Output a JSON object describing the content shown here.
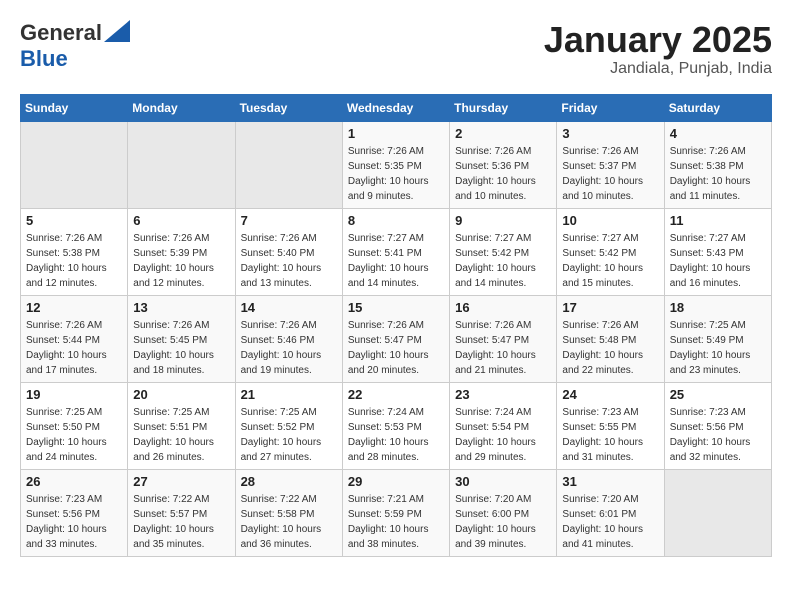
{
  "header": {
    "logo_line1": "General",
    "logo_line2": "Blue",
    "month": "January 2025",
    "location": "Jandiala, Punjab, India"
  },
  "days_of_week": [
    "Sunday",
    "Monday",
    "Tuesday",
    "Wednesday",
    "Thursday",
    "Friday",
    "Saturday"
  ],
  "weeks": [
    [
      {
        "day": "",
        "info": ""
      },
      {
        "day": "",
        "info": ""
      },
      {
        "day": "",
        "info": ""
      },
      {
        "day": "1",
        "info": "Sunrise: 7:26 AM\nSunset: 5:35 PM\nDaylight: 10 hours\nand 9 minutes."
      },
      {
        "day": "2",
        "info": "Sunrise: 7:26 AM\nSunset: 5:36 PM\nDaylight: 10 hours\nand 10 minutes."
      },
      {
        "day": "3",
        "info": "Sunrise: 7:26 AM\nSunset: 5:37 PM\nDaylight: 10 hours\nand 10 minutes."
      },
      {
        "day": "4",
        "info": "Sunrise: 7:26 AM\nSunset: 5:38 PM\nDaylight: 10 hours\nand 11 minutes."
      }
    ],
    [
      {
        "day": "5",
        "info": "Sunrise: 7:26 AM\nSunset: 5:38 PM\nDaylight: 10 hours\nand 12 minutes."
      },
      {
        "day": "6",
        "info": "Sunrise: 7:26 AM\nSunset: 5:39 PM\nDaylight: 10 hours\nand 12 minutes."
      },
      {
        "day": "7",
        "info": "Sunrise: 7:26 AM\nSunset: 5:40 PM\nDaylight: 10 hours\nand 13 minutes."
      },
      {
        "day": "8",
        "info": "Sunrise: 7:27 AM\nSunset: 5:41 PM\nDaylight: 10 hours\nand 14 minutes."
      },
      {
        "day": "9",
        "info": "Sunrise: 7:27 AM\nSunset: 5:42 PM\nDaylight: 10 hours\nand 14 minutes."
      },
      {
        "day": "10",
        "info": "Sunrise: 7:27 AM\nSunset: 5:42 PM\nDaylight: 10 hours\nand 15 minutes."
      },
      {
        "day": "11",
        "info": "Sunrise: 7:27 AM\nSunset: 5:43 PM\nDaylight: 10 hours\nand 16 minutes."
      }
    ],
    [
      {
        "day": "12",
        "info": "Sunrise: 7:26 AM\nSunset: 5:44 PM\nDaylight: 10 hours\nand 17 minutes."
      },
      {
        "day": "13",
        "info": "Sunrise: 7:26 AM\nSunset: 5:45 PM\nDaylight: 10 hours\nand 18 minutes."
      },
      {
        "day": "14",
        "info": "Sunrise: 7:26 AM\nSunset: 5:46 PM\nDaylight: 10 hours\nand 19 minutes."
      },
      {
        "day": "15",
        "info": "Sunrise: 7:26 AM\nSunset: 5:47 PM\nDaylight: 10 hours\nand 20 minutes."
      },
      {
        "day": "16",
        "info": "Sunrise: 7:26 AM\nSunset: 5:47 PM\nDaylight: 10 hours\nand 21 minutes."
      },
      {
        "day": "17",
        "info": "Sunrise: 7:26 AM\nSunset: 5:48 PM\nDaylight: 10 hours\nand 22 minutes."
      },
      {
        "day": "18",
        "info": "Sunrise: 7:25 AM\nSunset: 5:49 PM\nDaylight: 10 hours\nand 23 minutes."
      }
    ],
    [
      {
        "day": "19",
        "info": "Sunrise: 7:25 AM\nSunset: 5:50 PM\nDaylight: 10 hours\nand 24 minutes."
      },
      {
        "day": "20",
        "info": "Sunrise: 7:25 AM\nSunset: 5:51 PM\nDaylight: 10 hours\nand 26 minutes."
      },
      {
        "day": "21",
        "info": "Sunrise: 7:25 AM\nSunset: 5:52 PM\nDaylight: 10 hours\nand 27 minutes."
      },
      {
        "day": "22",
        "info": "Sunrise: 7:24 AM\nSunset: 5:53 PM\nDaylight: 10 hours\nand 28 minutes."
      },
      {
        "day": "23",
        "info": "Sunrise: 7:24 AM\nSunset: 5:54 PM\nDaylight: 10 hours\nand 29 minutes."
      },
      {
        "day": "24",
        "info": "Sunrise: 7:23 AM\nSunset: 5:55 PM\nDaylight: 10 hours\nand 31 minutes."
      },
      {
        "day": "25",
        "info": "Sunrise: 7:23 AM\nSunset: 5:56 PM\nDaylight: 10 hours\nand 32 minutes."
      }
    ],
    [
      {
        "day": "26",
        "info": "Sunrise: 7:23 AM\nSunset: 5:56 PM\nDaylight: 10 hours\nand 33 minutes."
      },
      {
        "day": "27",
        "info": "Sunrise: 7:22 AM\nSunset: 5:57 PM\nDaylight: 10 hours\nand 35 minutes."
      },
      {
        "day": "28",
        "info": "Sunrise: 7:22 AM\nSunset: 5:58 PM\nDaylight: 10 hours\nand 36 minutes."
      },
      {
        "day": "29",
        "info": "Sunrise: 7:21 AM\nSunset: 5:59 PM\nDaylight: 10 hours\nand 38 minutes."
      },
      {
        "day": "30",
        "info": "Sunrise: 7:20 AM\nSunset: 6:00 PM\nDaylight: 10 hours\nand 39 minutes."
      },
      {
        "day": "31",
        "info": "Sunrise: 7:20 AM\nSunset: 6:01 PM\nDaylight: 10 hours\nand 41 minutes."
      },
      {
        "day": "",
        "info": ""
      }
    ]
  ]
}
